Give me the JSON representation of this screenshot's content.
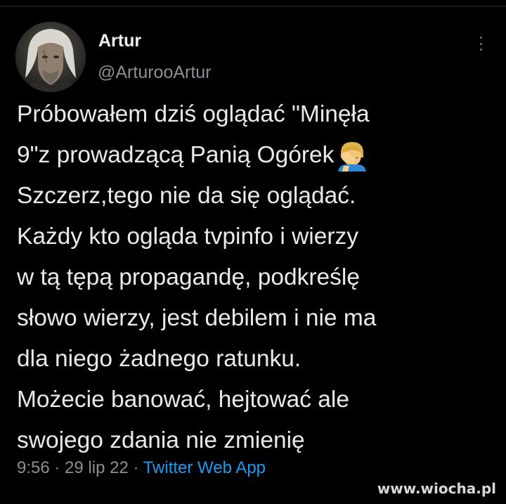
{
  "author": {
    "display_name": "Artur",
    "handle": "@ArturooArtur"
  },
  "tweet": {
    "lines": [
      "Próbowałem dziś oglądać \"Minęła",
      "9\"z prowadzącą Panią Ogórek",
      "Szczerz,tego nie da się oglądać.",
      "Każdy kto ogląda tvpinfo i wierzy",
      "w tą tępą propagandę, podkreślę",
      "słowo wierzy, jest debilem i nie ma",
      "dla niego żadnego ratunku.",
      "Możecie banować, hejtować ale",
      "swojego zdania nie zmienię"
    ],
    "emoji": "facepalm-emoji"
  },
  "meta": {
    "time": "9:56",
    "sep1": " · ",
    "date": "29 lip 22",
    "sep2": " · ",
    "app": "Twitter Web App"
  },
  "watermark": "www.wiocha.pl",
  "colors": {
    "background": "#000000",
    "text": "#e9eaeb",
    "secondary": "#8b8f94",
    "link": "#1d9bf0"
  }
}
